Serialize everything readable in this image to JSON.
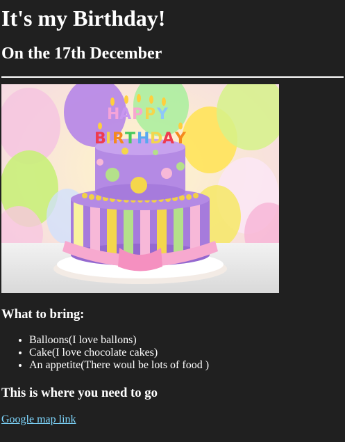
{
  "header": {
    "title": "It's my Birthday!",
    "date": "On the 17th December"
  },
  "image": {
    "icon": "birthday-cake-photo",
    "banner_text": "HAPPY BIRTHDAY"
  },
  "bring": {
    "heading": "What to bring:",
    "items": [
      "Balloons(I love ballons)",
      "Cake(I love chocolate cakes)",
      "An appetite(There woul be lots of food )"
    ]
  },
  "location": {
    "heading": "This is where you need to go",
    "link_text": "Google map link"
  },
  "colors": {
    "background": "#202020",
    "text": "#ffffff",
    "link": "#7fd8ff"
  }
}
